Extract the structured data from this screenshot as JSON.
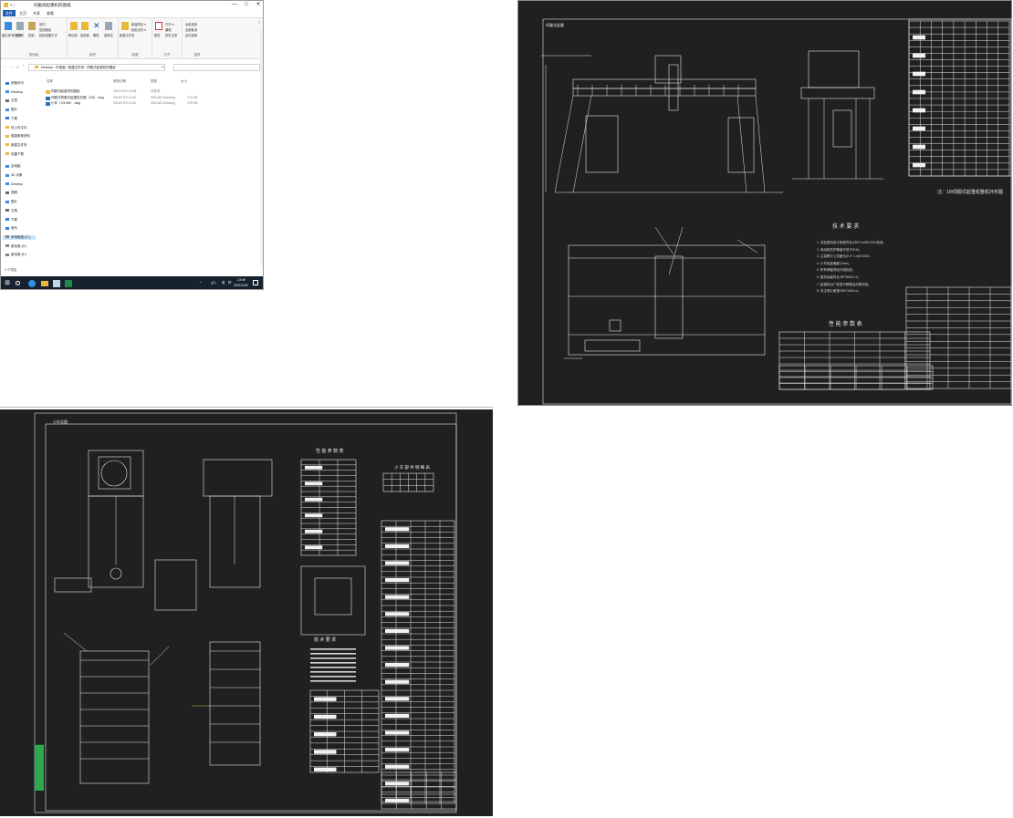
{
  "explorer": {
    "title": "伺服式起重机的图纸",
    "window_controls": {
      "minimize": "—",
      "maximize": "□",
      "close": "✕"
    },
    "tabs": [
      "文件",
      "主页",
      "共享",
      "查看"
    ],
    "ribbon": {
      "groups": [
        {
          "label": "剪贴板",
          "items": [
            "固定到'快速访问'",
            "复制",
            "粘贴",
            "剪切",
            "复制路径",
            "粘贴快捷方式"
          ]
        },
        {
          "label": "组织",
          "items": [
            "移动到",
            "复制到",
            "删除",
            "重命名"
          ]
        },
        {
          "label": "新建",
          "items": [
            "新建文件夹",
            "新建项目 ▾",
            "轻松访问 ▾"
          ]
        },
        {
          "label": "打开",
          "items": [
            "属性",
            "打开 ▾",
            "编辑",
            "历史记录"
          ]
        },
        {
          "label": "选择",
          "items": [
            "全部选择",
            "全部取消",
            "反向选择"
          ]
        }
      ]
    },
    "address_path": [
      "Desktop",
      "外桌面",
      "新建文件夹",
      "伺服式起重机的图纸"
    ],
    "search_placeholder": "",
    "nav": [
      {
        "label": "快速访问",
        "icon": "star-icon",
        "color": "#2f7ad6"
      },
      {
        "label": "Desktop",
        "icon": "desktop-icon",
        "color": "#3b8be0"
      },
      {
        "label": "文档",
        "icon": "document-icon",
        "color": "#5a6b7a"
      },
      {
        "label": "图片",
        "icon": "picture-icon",
        "color": "#3b8be0"
      },
      {
        "label": "下载",
        "icon": "download-icon",
        "color": "#2f7ad6"
      },
      {
        "label": "待上传文件",
        "icon": "folder-icon",
        "color": "#e8b93c"
      },
      {
        "label": "桃园家庭资料",
        "icon": "folder-icon",
        "color": "#e8b93c"
      },
      {
        "label": "新建文件夹",
        "icon": "folder-icon",
        "color": "#e8b93c"
      },
      {
        "label": "迅雷下载",
        "icon": "folder-icon",
        "color": "#e8b93c"
      },
      {
        "label": "此电脑",
        "icon": "computer-icon",
        "color": "#3b8be0"
      },
      {
        "label": "3D 对象",
        "icon": "cube-icon",
        "color": "#3b8be0"
      },
      {
        "label": "Desktop",
        "icon": "desktop-icon",
        "color": "#3b8be0"
      },
      {
        "label": "视频",
        "icon": "video-icon",
        "color": "#5a6b7a"
      },
      {
        "label": "图片",
        "icon": "picture-icon",
        "color": "#3b8be0"
      },
      {
        "label": "文档",
        "icon": "document-icon",
        "color": "#5a6b7a"
      },
      {
        "label": "下载",
        "icon": "download-icon",
        "color": "#2f7ad6"
      },
      {
        "label": "音乐",
        "icon": "music-icon",
        "color": "#2f7ad6"
      },
      {
        "label": "本地磁盘 (C:)",
        "icon": "drive-icon",
        "color": "#7a8894"
      },
      {
        "label": "新加卷 (D:)",
        "icon": "drive-icon",
        "color": "#7a8894"
      },
      {
        "label": "新加卷 (E:)",
        "icon": "drive-icon",
        "color": "#7a8894"
      }
    ],
    "columns": [
      "名称",
      "修改日期",
      "类型",
      "大小"
    ],
    "files": [
      {
        "name": "伺服式起重机的图纸",
        "date": "2021/1/26 13:48",
        "type": "文件夹",
        "size": "",
        "icon": "folder-icon",
        "color": "#e8b93c"
      },
      {
        "name": "伺服式伺服式起重机总图（10t）.dwg",
        "date": "2016/7/19 11:02",
        "type": "ZWCAD Drawing",
        "size": "172 KB",
        "icon": "dwg-file-icon",
        "color": "#2f6fb4"
      },
      {
        "name": "小车（10t M6）.dwg",
        "date": "2016/7/19 11:02",
        "type": "ZWCAD Drawing",
        "size": "175 KB",
        "icon": "dwg-file-icon",
        "color": "#2f6fb4"
      }
    ],
    "status": "3 个项目"
  },
  "taskbar": {
    "bg_color": "#16232e",
    "icons": [
      "windows-start-icon",
      "search-icon",
      "edge-browser-icon",
      "file-explorer-icon",
      "cad-app-icon",
      "excel-icon"
    ],
    "tray": {
      "expand": "^",
      "volume": "🔊)",
      "ime": "英",
      "ime2": "拼",
      "time": "13:49",
      "date": "2021/1/26"
    }
  },
  "cad_top": {
    "frame_label": "伺服式起重",
    "tech_title": "技 术 要 求",
    "tech_notes": [
      "1. 本起重机设计制造符合GB/T14405-2011标准。",
      "2. 电动机防护等级不低于IP44。",
      "3. 主梁跨中上拱度为(0.9~1.4)S/1000。",
      "4. 小车轨距偏差±3mm。",
      "5. 所有焊缝须经外观检查。",
      "6. 整机涂装符合JB/T5000.12。",
      "7. 起重机出厂前进行静载及动载试验。",
      "8. 未注明公差按GB/T1804-m。"
    ],
    "perf_title": "性 能 参 数 表",
    "side_note": "注：10t伺服式起重机整机外形图",
    "bg_color": "#1e2022",
    "line_color": "#e6e6e6"
  },
  "cad_bottom": {
    "frame_label": "小车总图",
    "tech_title": "技 术 要 求",
    "perf_title": "性 能 参 数 表",
    "part_list_title": "小 车 部 件 明 细 表",
    "bg_color": "#1e2022",
    "line_color": "#e6e6e6"
  }
}
